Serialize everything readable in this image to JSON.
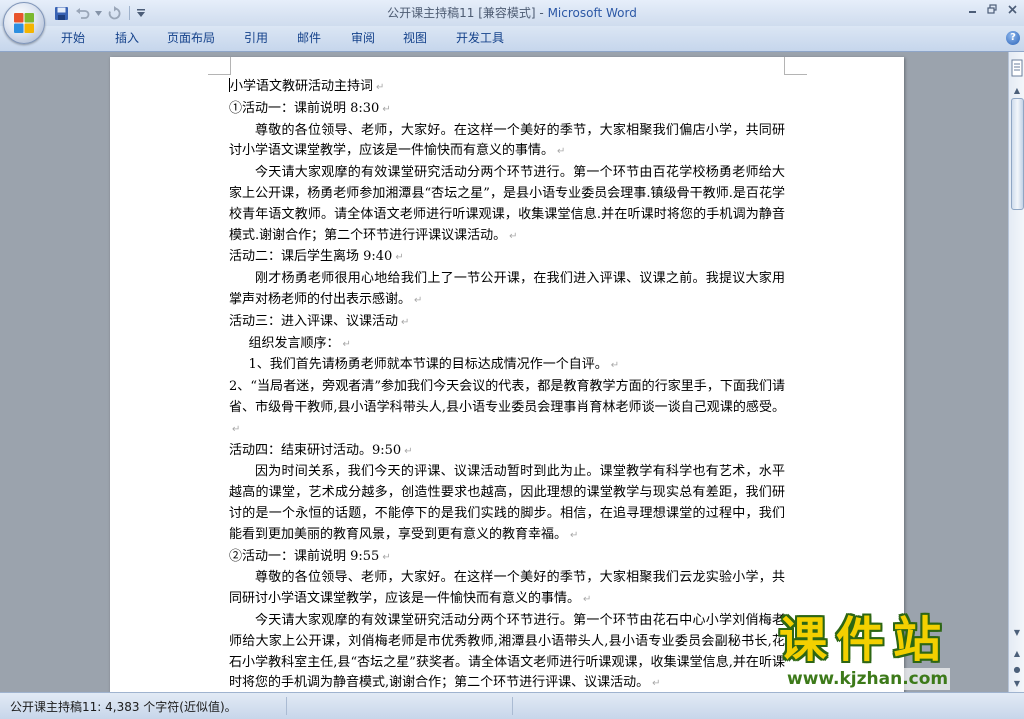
{
  "window": {
    "title": "公开课主持稿11 [兼容模式]",
    "separator": " - ",
    "app_name": "Microsoft Word"
  },
  "ribbon": {
    "tabs": [
      "开始",
      "插入",
      "页面布局",
      "引用",
      "邮件",
      "审阅",
      "视图",
      "开发工具"
    ]
  },
  "document": {
    "paragraphs": [
      {
        "text": "小学语文教研活动主持词",
        "style": "plain"
      },
      {
        "text": "①活动一：课前说明 8:30",
        "style": "plain"
      },
      {
        "text": "尊敬的各位领导、老师，大家好。在这样一个美好的季节，大家相聚我们偏店小学，共同研讨小学语文课堂教学，应该是一件愉快而有意义的事情。",
        "style": "indent"
      },
      {
        "text": "今天请大家观摩的有效课堂研究活动分两个环节进行。第一个环节由百花学校杨勇老师给大家上公开课，杨勇老师参加湘潭县“杏坛之星”，是县小语专业委员会理事.镇级骨干教师.是百花学校青年语文教师。请全体语文老师进行听课观课，收集课堂信息.并在听课时将您的手机调为静音模式.谢谢合作；第二个环节进行评课议课活动。",
        "style": "indent"
      },
      {
        "text": "活动二：课后学生离场 9:40",
        "style": "plain"
      },
      {
        "text": "刚才杨勇老师很用心地给我们上了一节公开课，在我们进入评课、议课之前。我提议大家用掌声对杨老师的付出表示感谢。",
        "style": "indent"
      },
      {
        "text": "活动三：进入评课、议课活动",
        "style": "plain"
      },
      {
        "text": "组织发言顺序：",
        "style": "indent1"
      },
      {
        "text": "1、我们首先请杨勇老师就本节课的目标达成情况作一个自评。",
        "style": "indent1"
      },
      {
        "text": "2、“当局者迷，旁观者清”参加我们今天会议的代表，都是教育教学方面的行家里手，下面我们请省、市级骨干教师,县小语学科带头人,县小语专业委员会理事肖育林老师谈一谈自己观课的感受。",
        "style": "plain"
      },
      {
        "text": "活动四：结束研讨活动。9:50",
        "style": "plain"
      },
      {
        "text": "因为时间关系，我们今天的评课、议课活动暂时到此为止。课堂教学有科学也有艺术，水平越高的课堂，艺术成分越多，创造性要求也越高，因此理想的课堂教学与现实总有差距，我们研讨的是一个永恒的话题，不能停下的是我们实践的脚步。相信，在追寻理想课堂的过程中，我们能看到更加美丽的教育风景，享受到更有意义的教育幸福。",
        "style": "indent"
      },
      {
        "text": "②活动一：课前说明 9:55",
        "style": "plain"
      },
      {
        "text": "尊敬的各位领导、老师，大家好。在这样一个美好的季节，大家相聚我们云龙实验小学，共同研讨小学语文课堂教学，应该是一件愉快而有意义的事情。",
        "style": "indent"
      },
      {
        "text": "今天请大家观摩的有效课堂研究活动分两个环节进行。第一个环节由花石中心小学刘俏梅老师给大家上公开课，刘俏梅老师是市优秀教师,湘潭县小语带头人,县小语专业委员会副秘书长,花石小学教科室主任,县“杏坛之星”获奖者。请全体语文老师进行听课观课，收集课堂信息,并在听课时将您的手机调为静音模式,谢谢合作；第二个环节进行评课、议课活动。",
        "style": "indent"
      }
    ]
  },
  "statusbar": {
    "text": "公开课主持稿11: 4,383 个字符(近似值)。"
  },
  "watermark": {
    "title": "课件站",
    "url": "www.kjzhan.com"
  },
  "colors": {
    "ribbon_text": "#15428b",
    "app_name": "#2c58a6",
    "workspace": "#9ba3ad"
  }
}
